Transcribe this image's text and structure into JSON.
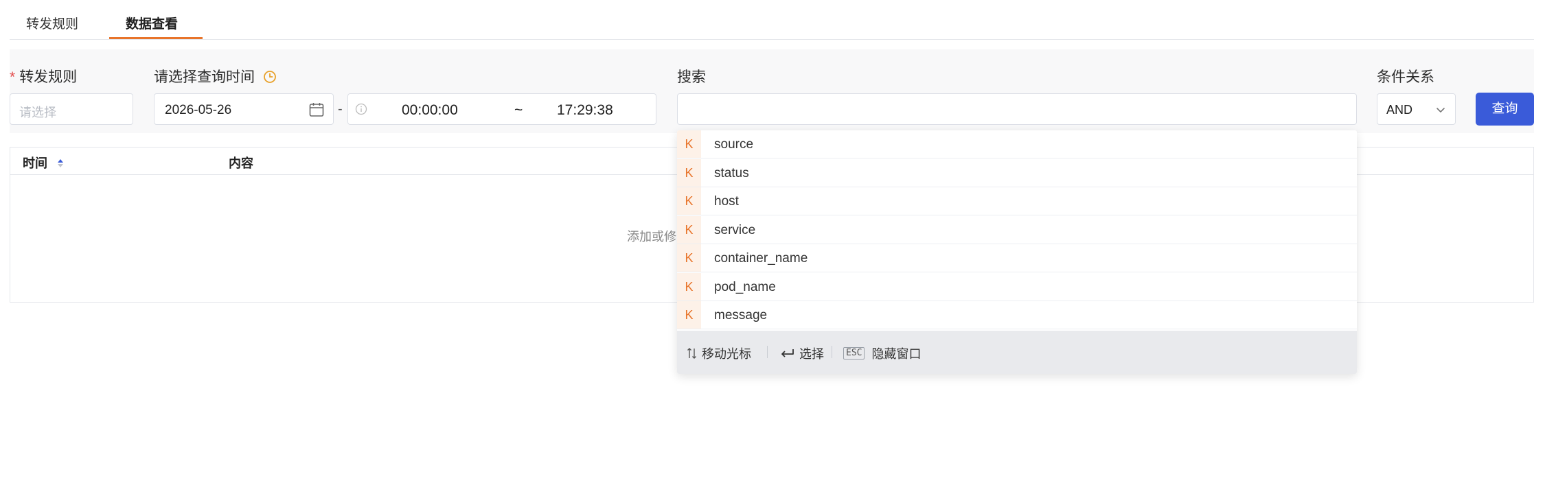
{
  "tabs": [
    {
      "label": "转发规则",
      "active": false
    },
    {
      "label": "数据查看",
      "active": true
    }
  ],
  "filters": {
    "rule": {
      "label": "转发规则",
      "placeholder": "请选择",
      "required": true
    },
    "time": {
      "label": "请选择查询时间",
      "date": "2026-05-26",
      "start": "00:00:00",
      "separator": "~",
      "end": "17:29:38",
      "dash": "-"
    },
    "search": {
      "label": "搜索",
      "value": ""
    },
    "logic": {
      "label": "条件关系",
      "value": "AND"
    },
    "query_label": "查询"
  },
  "table": {
    "columns": [
      "时间",
      "内容"
    ],
    "empty_text": "添加或修"
  },
  "suggestions": {
    "badge": "K",
    "items": [
      "source",
      "status",
      "host",
      "service",
      "container_name",
      "pod_name",
      "message"
    ],
    "footer": {
      "move": "移动光标",
      "select": "选择",
      "esc_key": "ESC",
      "hide": "隐藏窗口"
    }
  },
  "colors": {
    "accent": "#e8742a",
    "primary": "#3a5bd9",
    "required": "#e34d4d"
  }
}
